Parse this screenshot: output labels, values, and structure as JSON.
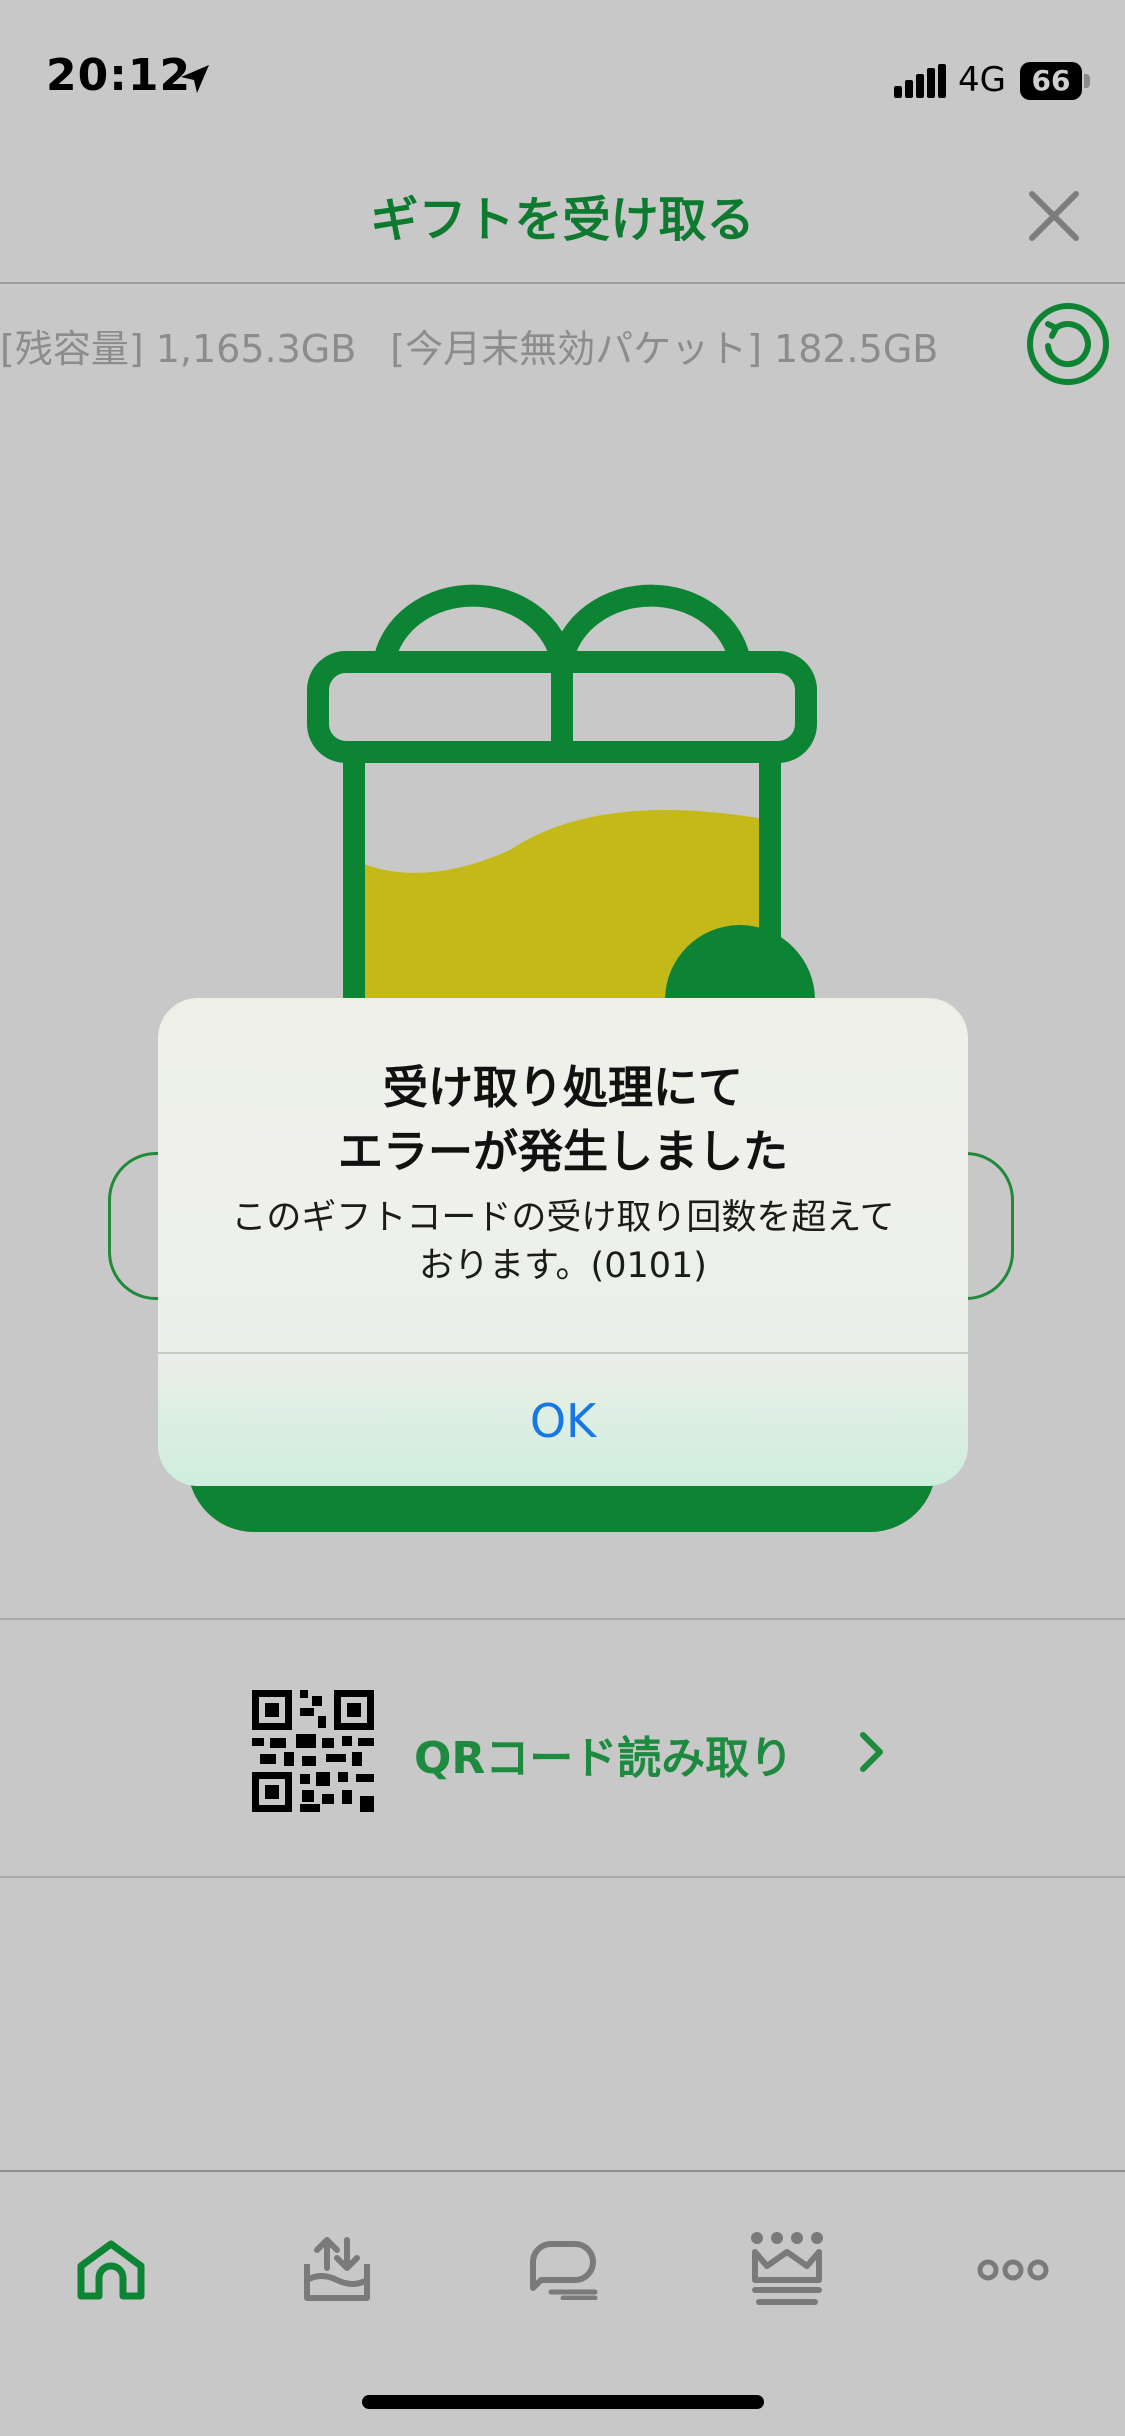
{
  "status_bar": {
    "time": "20:12",
    "network": "4G",
    "battery": "66"
  },
  "header": {
    "title": "ギフトを受け取る"
  },
  "capacity": {
    "remaining": "[残容量] 1,165.3GB",
    "expiring": "[今月末無効パケット] 182.5GB"
  },
  "qr": {
    "label": "QRコード読み取り"
  },
  "alert": {
    "title_line1": "受け取り処理にて",
    "title_line2": "エラーが発生しました",
    "message_line1": "このギフトコードの受け取り回数を超えて",
    "message_line2": "おります。(0101)",
    "ok_label": "OK"
  },
  "colors": {
    "brand_green": "#0d7a30",
    "alert_link": "#1677e5",
    "gift_fill": "#c5b919"
  },
  "tabs": [
    {
      "icon": "home-icon",
      "active": true
    },
    {
      "icon": "share-data-icon",
      "active": false
    },
    {
      "icon": "chat-icon",
      "active": false
    },
    {
      "icon": "crown-icon",
      "active": false
    },
    {
      "icon": "more-icon",
      "active": false
    }
  ]
}
